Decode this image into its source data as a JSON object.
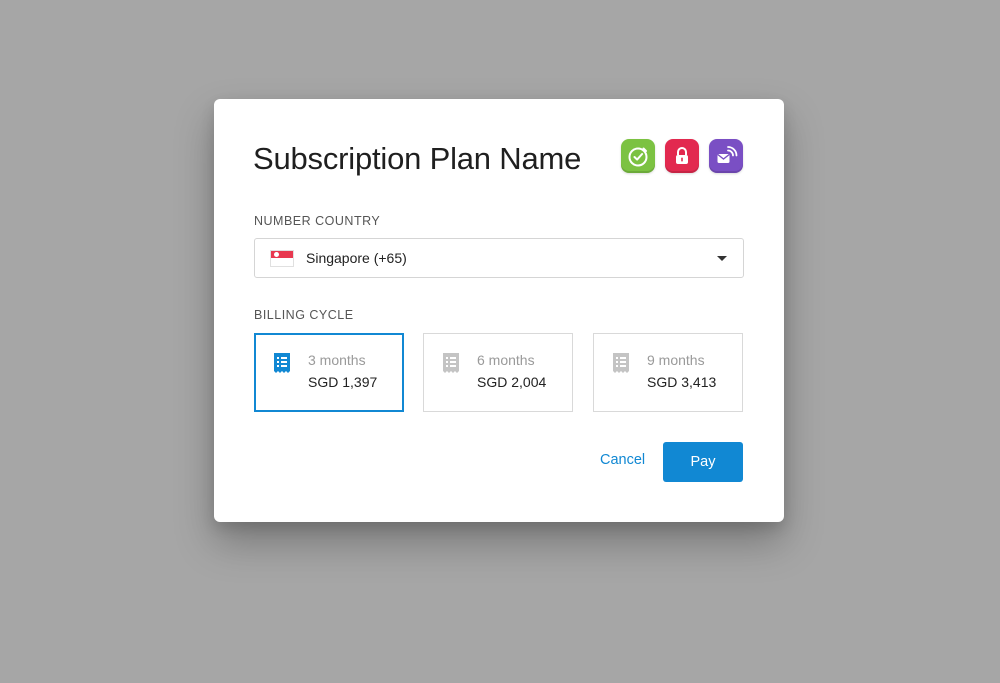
{
  "dialog": {
    "title": "Subscription Plan Name",
    "app_icons": [
      {
        "name": "timer-app-icon",
        "color": "#7cc242"
      },
      {
        "name": "lock-app-icon",
        "color": "#e2294f"
      },
      {
        "name": "message-app-icon",
        "color": "#7a4fc4"
      }
    ]
  },
  "country": {
    "label": "NUMBER COUNTRY",
    "selected": "Singapore (+65)",
    "flag_icon": "singapore-flag-icon"
  },
  "billing": {
    "label": "BILLING CYCLE",
    "options": [
      {
        "period": "3 months",
        "price": "SGD 1,397",
        "selected": true
      },
      {
        "period": "6 months",
        "price": "SGD 2,004",
        "selected": false
      },
      {
        "period": "9 months",
        "price": "SGD 3,413",
        "selected": false
      }
    ]
  },
  "actions": {
    "cancel_label": "Cancel",
    "pay_label": "Pay"
  },
  "colors": {
    "accent": "#1188d3",
    "backdrop": "#a6a6a6"
  }
}
